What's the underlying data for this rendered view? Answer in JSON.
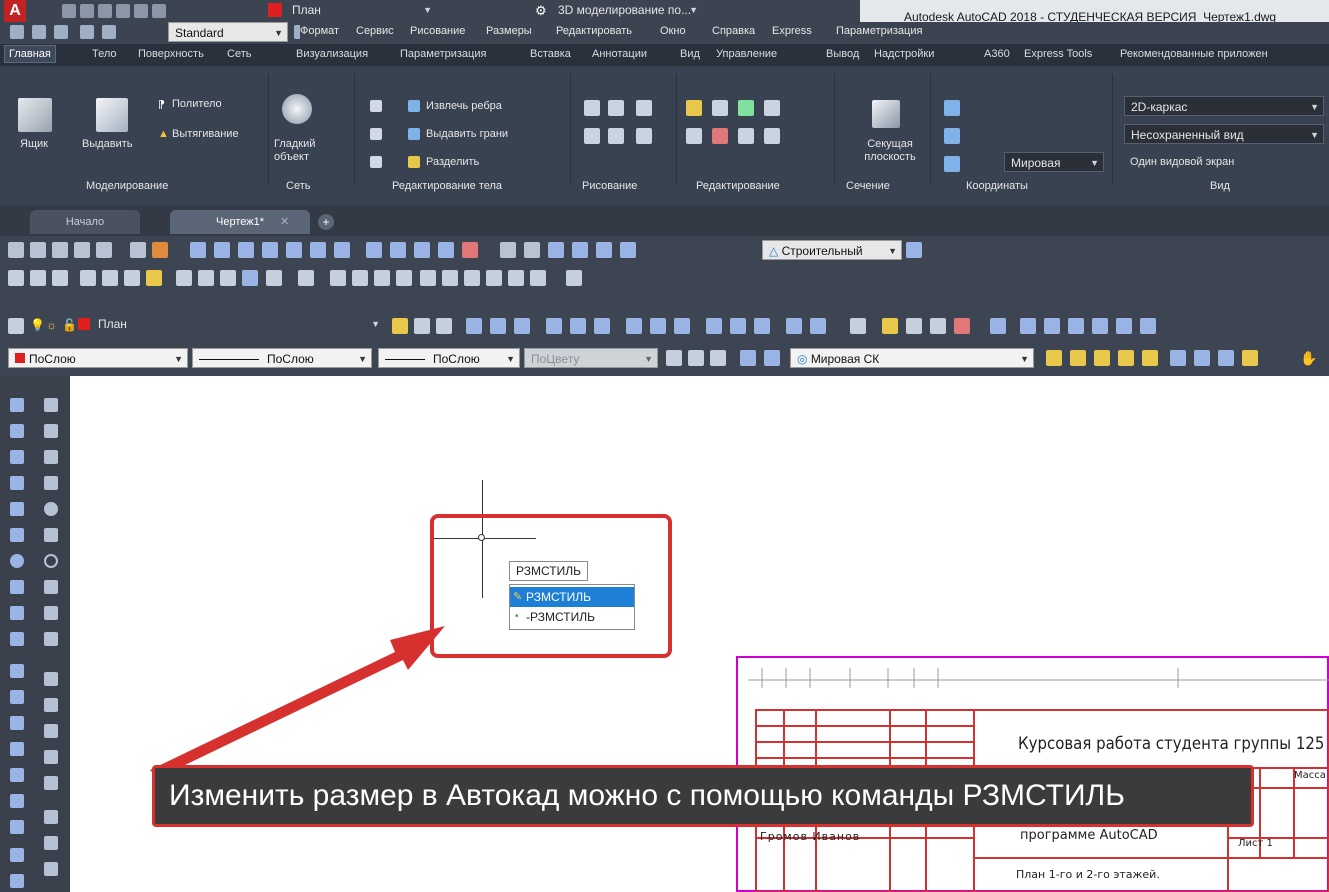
{
  "app": {
    "title": "Autodesk AutoCAD 2018 - СТУДЕНЧЕСКАЯ ВЕРСИЯ",
    "file": "Чертеж1.dwg",
    "logo": "A",
    "workspace": "3D моделирование по...",
    "layer_quick": "План",
    "style_combo": "Standard"
  },
  "menu": [
    "Формат",
    "Сервис",
    "Рисование",
    "Размеры",
    "Редактировать",
    "Окно",
    "Справка",
    "Express",
    "Параметризация"
  ],
  "ribbon_tabs": [
    "Главная",
    "Тело",
    "Поверхность",
    "Сеть",
    "Визуализация",
    "Параметризация",
    "Вставка",
    "Аннотации",
    "Вид",
    "Управление",
    "Вывод",
    "Надстройки",
    "A360",
    "Express Tools",
    "Рекомендованные приложен"
  ],
  "ribbon": {
    "box_label": "Ящик",
    "extrude_label": "Выдавить",
    "polysolid": "Политело",
    "presspull": "Вытягивание",
    "smooth_object": "Гладкий объект",
    "extract_edges": "Извлечь ребра",
    "extrude_faces": "Выдавить грани",
    "separate": "Разделить",
    "section_plane": "Секущая плоскость",
    "wireframe": "2D-каркас",
    "unsaved_view": "Несохраненный вид",
    "world": "Мировая",
    "single_viewport": "Один видовой экран",
    "panels": [
      "Моделирование",
      "Сеть",
      "Редактирование тела",
      "Рисование",
      "Редактирование",
      "Сечение",
      "Координаты",
      "Вид"
    ]
  },
  "file_tabs": [
    "Начало",
    "Чертеж1*"
  ],
  "toolbars": {
    "dim_style": "Строительный",
    "layer": "План",
    "color": "ПоСлою",
    "linetype": "ПоСлою",
    "lineweight": "ПоСлою",
    "plotstyle": "ПоЦвету",
    "ucs": "Мировая СК"
  },
  "command": {
    "typed": "РЗМСТИЛЬ",
    "suggestions": [
      "РЗМСТИЛЬ",
      "-РЗМСТИЛЬ"
    ]
  },
  "caption": "Изменить размер в Автокад можно с помощью команды РЗМСТИЛЬ",
  "sheet": {
    "title_main": "Курсовая работа студента группы 125",
    "program": "программе AutoCAD",
    "plan": "План 1-го и 2-го этажей.",
    "name": "Громов Иванов",
    "sheet_label": "Лист 1",
    "stage": "Масса"
  },
  "colors": {
    "accent_red": "#d7312f",
    "title_bar": "#3c4452",
    "selection_blue": "#1e7fd6",
    "sheet_frame": "#d000d0"
  }
}
